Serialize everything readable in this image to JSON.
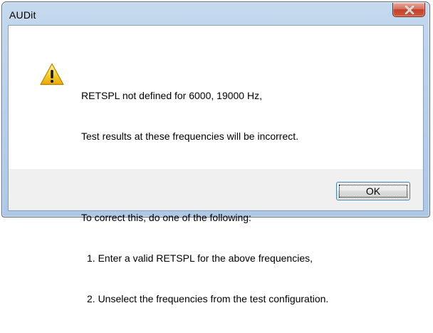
{
  "window": {
    "title": "AUDit",
    "close_symbol": "close-icon"
  },
  "dialog": {
    "icon": "warning-icon",
    "lines": [
      "RETSPL not defined for 6000, 19000 Hz,",
      "Test results at these frequencies will be incorrect.",
      "",
      "To correct this, do one of the following:",
      "1. Enter a valid RETSPL for the above frequencies,",
      "2. Unselect the frequencies from the test configuration."
    ],
    "ok_label": "OK"
  },
  "colors": {
    "titlebar": "#bad1ea",
    "close_button": "#c74a33",
    "warning_yellow": "#f5c518",
    "button_border": "#3c7fb1"
  }
}
